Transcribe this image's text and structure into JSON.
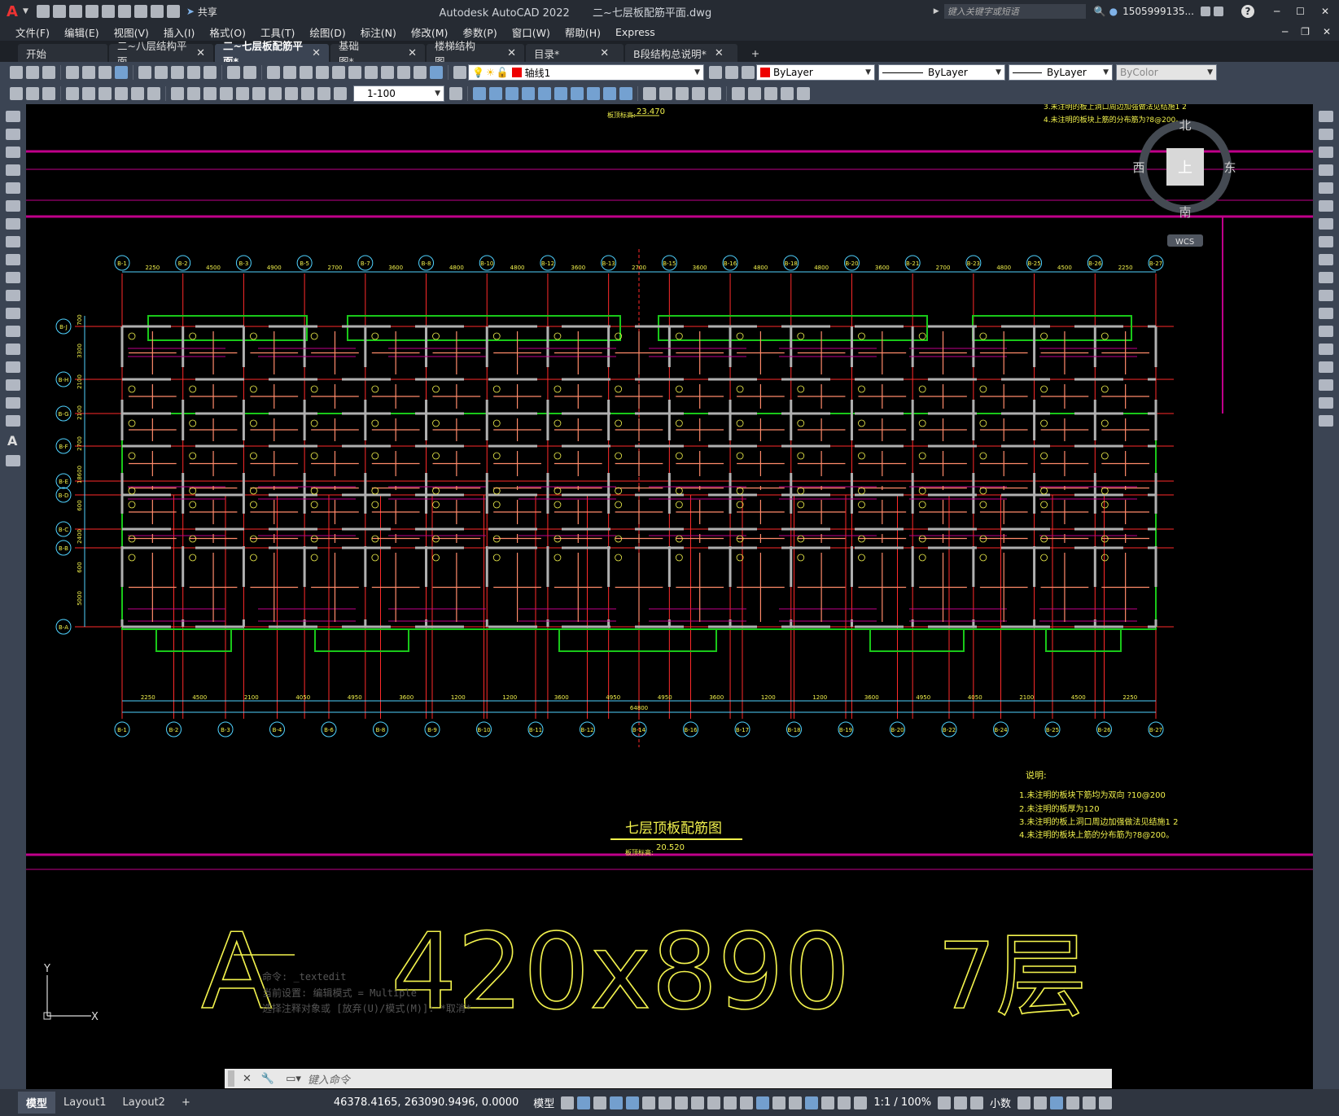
{
  "app": {
    "logo": "A",
    "title": "Autodesk AutoCAD 2022",
    "filename": "二~七层板配筋平面.dwg",
    "share_label": "共享",
    "search_placeholder": "键入关键字或短语",
    "user": "1505999135...",
    "help": "?"
  },
  "menu": [
    "文件(F)",
    "编辑(E)",
    "视图(V)",
    "插入(I)",
    "格式(O)",
    "工具(T)",
    "绘图(D)",
    "标注(N)",
    "修改(M)",
    "参数(P)",
    "窗口(W)",
    "帮助(H)",
    "Express"
  ],
  "tabs": [
    {
      "label": "开始",
      "close": false,
      "active": false
    },
    {
      "label": "二~八层结构平面",
      "close": true,
      "active": false
    },
    {
      "label": "二~七层板配筋平面*",
      "close": true,
      "active": true
    },
    {
      "label": "基础图*",
      "close": true,
      "active": false
    },
    {
      "label": "楼梯结构图",
      "close": true,
      "active": false
    },
    {
      "label": "目录*",
      "close": true,
      "active": false
    },
    {
      "label": "B段结构总说明*",
      "close": true,
      "active": false
    }
  ],
  "toolbar": {
    "layer": "轴线1",
    "color": "ByLayer",
    "linetype": "ByLayer",
    "lineweight": "ByLayer",
    "plotstyle": "ByColor",
    "scale": "1-100"
  },
  "viewcube": {
    "north": "北",
    "south": "南",
    "west": "西",
    "east": "东",
    "top": "上",
    "wcs": "WCS"
  },
  "drawing": {
    "title": "七层顶板配筋图",
    "elev_top": "23.470",
    "elev_bottom": "20.520",
    "elev_label": "板顶标高:",
    "notes_title": "说明:",
    "notes": [
      "1.未注明的板块下筋均为双向 ?10@200",
      "2.未注明的板厚为120",
      "3.未注明的板上洞口周边加强做法见结施1 2",
      "4.未注明的板块上筋的分布筋为?8@200。"
    ],
    "notes_top": [
      "3.未注明的板上洞口周边加强做法见结施1 2",
      "4.未注明的板块上筋的分布筋为?8@200。"
    ],
    "axes_top": [
      "B-1",
      "B-2",
      "B-3",
      "B-5",
      "B-7",
      "B-8",
      "B-10",
      "B-12",
      "B-13",
      "B-15",
      "B-16",
      "B-18",
      "B-20",
      "B-21",
      "B-23",
      "B-25",
      "B-26",
      "B-27"
    ],
    "axes_bottom": [
      "B-1",
      "B-2",
      "B-3",
      "B-4",
      "B-6",
      "B-8",
      "B-9",
      "B-10",
      "B-11",
      "B-12",
      "B-14",
      "B-16",
      "B-17",
      "B-18",
      "B-19",
      "B-20",
      "B-22",
      "B-24",
      "B-25",
      "B-26",
      "B-27"
    ],
    "axes_left": [
      "B-J",
      "B-H",
      "B-G",
      "B-F",
      "B-E",
      "B-D",
      "B-C",
      "B-B",
      "B-A"
    ],
    "dims_top": [
      "2250",
      "4500",
      "4900",
      "2700",
      "3600",
      "4800",
      "4800",
      "3600",
      "2700",
      "3600",
      "4800",
      "4800",
      "3600",
      "2700",
      "4800",
      "4500",
      "2250"
    ],
    "dims_bottom": [
      "2250",
      "4500",
      "2100",
      "4050",
      "4950",
      "3600",
      "1200",
      "1200",
      "3600",
      "4950",
      "4950",
      "3600",
      "1200",
      "1200",
      "3600",
      "4950",
      "4050",
      "2100",
      "4500",
      "2250"
    ],
    "total_dim": "64800",
    "dims_left": [
      "700",
      "3300",
      "2100",
      "2100",
      "2700",
      "18600",
      "600",
      "2400",
      "600",
      "5000"
    ],
    "big_text": [
      "A",
      "420x890",
      "7层"
    ]
  },
  "command": {
    "history": [
      "命令: _textedit",
      "当前设置: 编辑模式 = Multiple",
      "选择注释对象或 [放弃(U)/模式(M)]: *取消*"
    ],
    "placeholder": "键入命令"
  },
  "layouts": [
    "模型",
    "Layout1",
    "Layout2",
    "+"
  ],
  "status": {
    "coords": "46378.4165, 263090.9496, 0.0000",
    "mode": "模型",
    "scale": "1:1 / 100%",
    "units": "小数"
  },
  "colors": {
    "magenta": "#c0008a",
    "axis_red": "#ff2a2a",
    "wall": "#b0b0b0",
    "green": "#19c819",
    "rebar": "#ff8a6a",
    "text_yellow": "#f2f24d",
    "cyan": "#4fd2ff"
  }
}
